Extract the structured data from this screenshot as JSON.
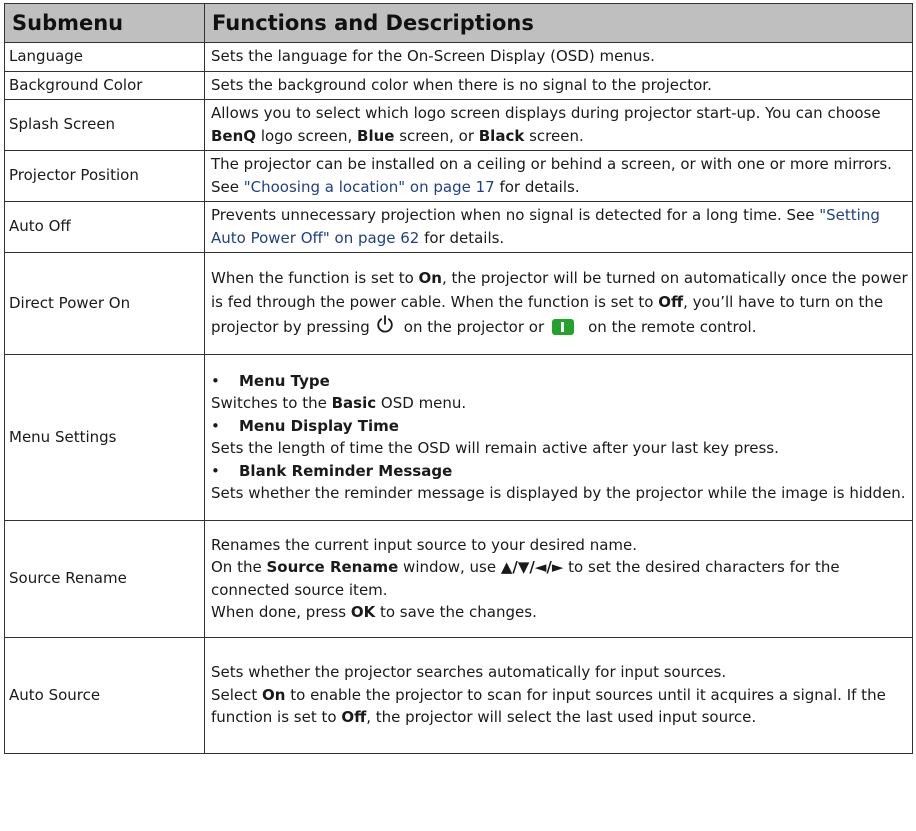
{
  "header": {
    "col1": "Submenu",
    "col2": "Functions and Descriptions"
  },
  "rows": [
    {
      "name": "Language",
      "desc": "Sets the language for the On-Screen Display (OSD) menus."
    },
    {
      "name": "Background Color",
      "desc": "Sets the background color when there is no signal to the projector."
    },
    {
      "name": "Splash Screen",
      "p1": "Allows you to select which logo screen displays during projector start-up. You can choose ",
      "b1": "BenQ",
      "p2": " logo screen, ",
      "b2": "Blue",
      "p3": " screen, or ",
      "b3": "Black",
      "p4": " screen."
    },
    {
      "name": "Projector Position",
      "p1": "The projector can be installed on a ceiling or behind a screen, or with one or more mirrors. See ",
      "ref": "\"Choosing a location\" on page 17",
      "p2": " for details."
    },
    {
      "name": "Auto Off",
      "p1": "Prevents unnecessary projection when no signal is detected for a long time. See ",
      "ref": "\"Setting Auto Power Off\" on page 62",
      "p2": " for details."
    },
    {
      "name": "Direct Power On",
      "p1": "When the function is set to ",
      "b1": "On",
      "p2": ", the projector will be turned on automatically once the power is fed through the power cable. When the function is set to ",
      "b2": "Off",
      "p3": ", you’ll have to turn on the projector by pressing",
      "p4": "on the projector or",
      "p5": "on the remote control.",
      "icons": [
        "power-icon",
        "remote-power-key-icon"
      ]
    },
    {
      "name": "Menu Settings",
      "bullet": "•",
      "h1": "Menu Type",
      "t1a": "Switches to the ",
      "t1b": "Basic",
      "t1c": " OSD menu.",
      "h2": "Menu Display Time",
      "t2": "Sets the length of time the OSD will remain active after your last key press.",
      "h3": "Blank Reminder Message",
      "t3": "Sets whether the reminder message is displayed by the projector while the image is hidden."
    },
    {
      "name": "Source Rename",
      "l1": "Renames the current input source to your desired name.",
      "l2a": "On the ",
      "l2b": "Source Rename",
      "l2c": " window, use ",
      "l2d": "▲/▼/◄/►",
      "l2e": " to set the desired characters for the connected source item.",
      "l3a": "When done, press ",
      "l3b": "OK",
      "l3c": " to save the changes."
    },
    {
      "name": "Auto Source",
      "l1": "Sets whether the projector searches automatically for input sources.",
      "l2a": "Select ",
      "l2b": "On",
      "l2c": " to enable the projector to scan for input sources until it acquires a signal. If the function is set to ",
      "l2d": "Off",
      "l2e": ", the projector will select the last used input source."
    }
  ]
}
